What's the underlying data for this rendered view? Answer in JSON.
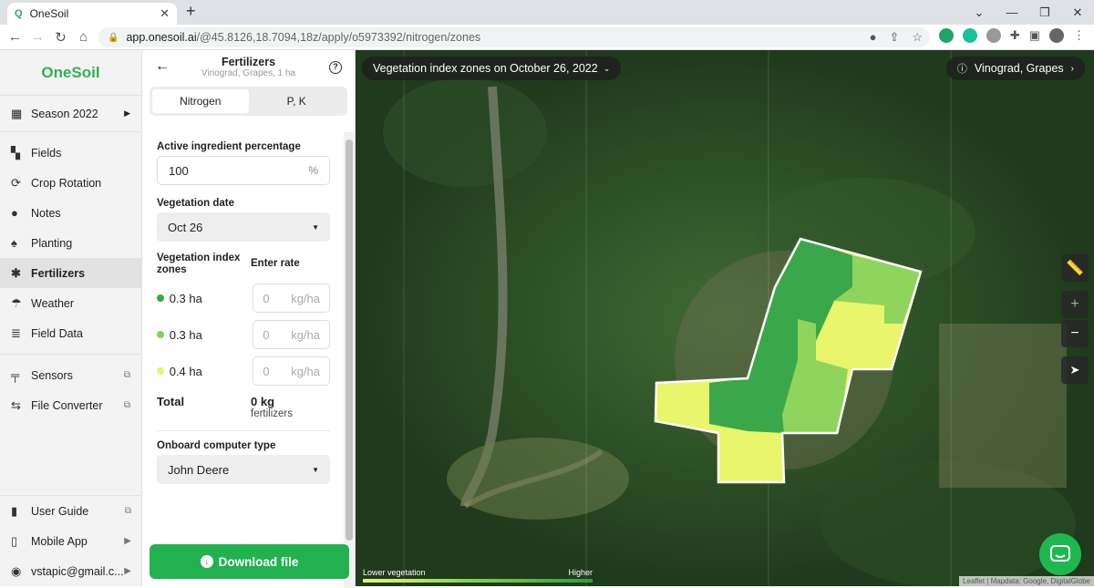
{
  "browser": {
    "tab_title": "OneSoil",
    "tab_favicon": "Q",
    "url_host": "app.onesoil.ai",
    "url_path": "/@45.8126,18.7094,18z/apply/o5973392/nitrogen/zones"
  },
  "sidebar": {
    "logo": "OneSoil",
    "season": "Season 2022",
    "items": [
      {
        "label": "Fields",
        "icon": "fields-icon"
      },
      {
        "label": "Crop Rotation",
        "icon": "crop-rotation-icon"
      },
      {
        "label": "Notes",
        "icon": "pin-icon"
      },
      {
        "label": "Planting",
        "icon": "seed-icon"
      },
      {
        "label": "Fertilizers",
        "icon": "fertilizer-icon"
      },
      {
        "label": "Weather",
        "icon": "umbrella-icon"
      },
      {
        "label": "Field Data",
        "icon": "database-icon"
      }
    ],
    "tools": [
      {
        "label": "Sensors"
      },
      {
        "label": "File Converter"
      }
    ],
    "bottom": [
      {
        "label": "User Guide"
      },
      {
        "label": "Mobile App"
      },
      {
        "label": "vstapic@gmail.c..."
      }
    ]
  },
  "panel": {
    "title": "Fertilizers",
    "subtitle": "Vinograd, Grapes, 1 ha",
    "tabs": [
      "Nitrogen",
      "P, K"
    ],
    "active_label": "Active ingredient percentage",
    "active_value": "100",
    "active_unit": "%",
    "veg_date_label": "Vegetation date",
    "veg_date_value": "Oct 26",
    "zones_label": "Vegetation index zones",
    "rate_label": "Enter rate",
    "zones": [
      {
        "area": "0.3 ha",
        "color": "#3aa84a",
        "rate": "0",
        "unit": "kg/ha"
      },
      {
        "area": "0.3 ha",
        "color": "#82d15a",
        "rate": "0",
        "unit": "kg/ha"
      },
      {
        "area": "0.4 ha",
        "color": "#e6f46b",
        "rate": "0",
        "unit": "kg/ha"
      }
    ],
    "total_label": "Total",
    "total_value": "0 kg",
    "total_sub": "fertilizers",
    "onboard_label": "Onboard computer type",
    "onboard_value": "John Deere",
    "download": "Download file"
  },
  "map": {
    "date_chip": "Vegetation index zones on October 26, 2022",
    "field_chip": "Vinograd, Grapes",
    "legend_low": "Lower vegetation",
    "legend_high": "Higher",
    "attribution": "Leaflet | Mapdata: Google, DigitalGlobe"
  }
}
